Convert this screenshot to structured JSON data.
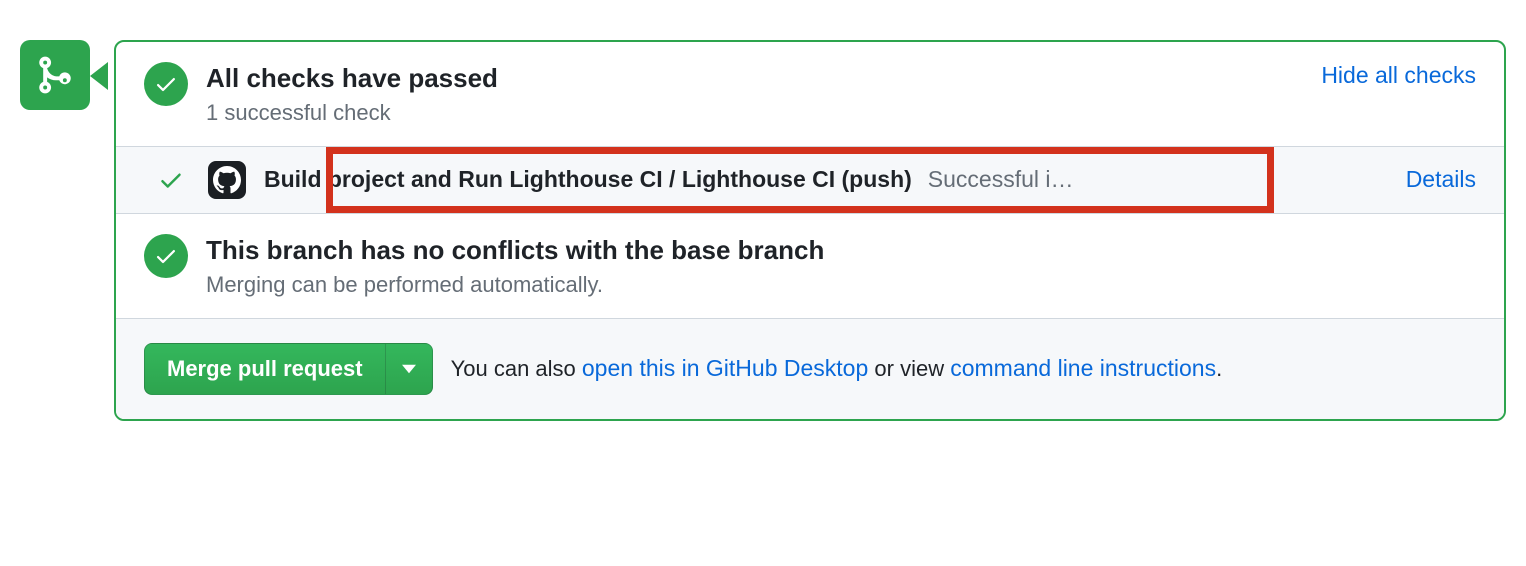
{
  "checks": {
    "title": "All checks have passed",
    "subtitle": "1 successful check",
    "toggle_link": "Hide all checks",
    "items": [
      {
        "name": "Build project and Run Lighthouse CI / Lighthouse CI (push)",
        "status_text": "Successful i…",
        "details_link": "Details"
      }
    ]
  },
  "conflicts": {
    "title": "This branch has no conflicts with the base branch",
    "subtitle": "Merging can be performed automatically."
  },
  "merge": {
    "button_label": "Merge pull request",
    "hint_prefix": "You can also ",
    "desktop_link": "open this in GitHub Desktop",
    "hint_middle": " or view ",
    "cli_link": "command line instructions",
    "hint_suffix": "."
  }
}
